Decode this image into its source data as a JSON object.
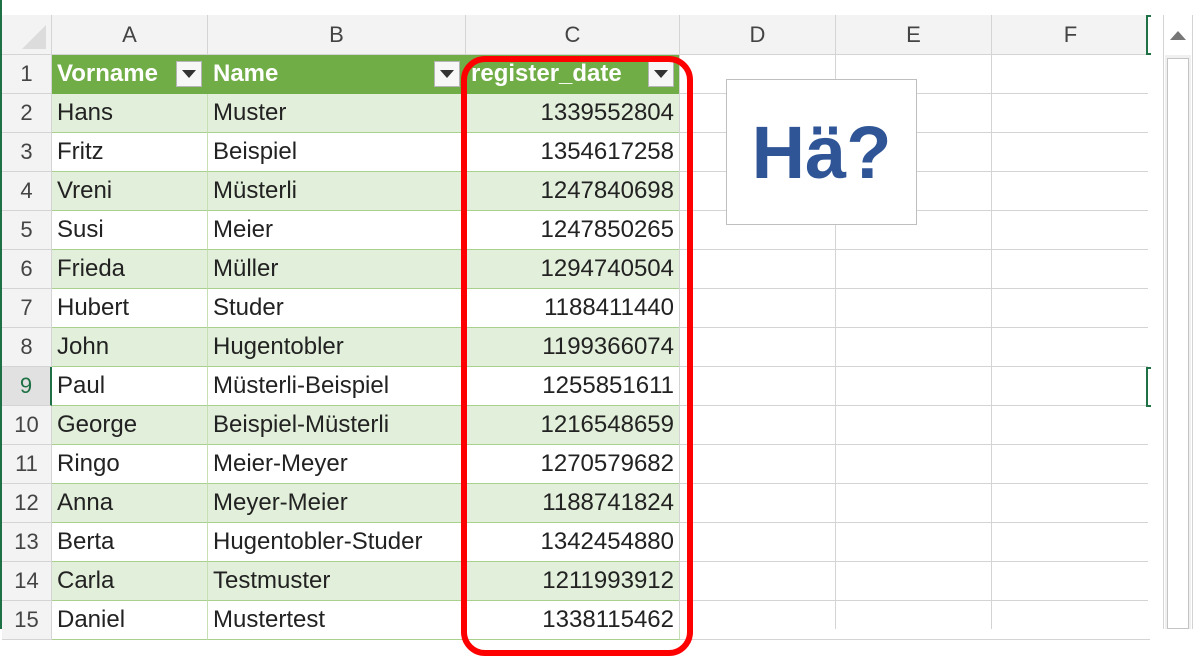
{
  "columns": [
    "A",
    "B",
    "C",
    "D",
    "E",
    "F"
  ],
  "row_numbers": [
    "1",
    "2",
    "3",
    "4",
    "5",
    "6",
    "7",
    "8",
    "9",
    "10",
    "11",
    "12",
    "13",
    "14",
    "15"
  ],
  "selected_row": "9",
  "table": {
    "headers": [
      "Vorname",
      "Name",
      "register_date"
    ],
    "rows": [
      [
        "Hans",
        "Muster",
        "1339552804"
      ],
      [
        "Fritz",
        "Beispiel",
        "1354617258"
      ],
      [
        "Vreni",
        "Müsterli",
        "1247840698"
      ],
      [
        "Susi",
        "Meier",
        "1247850265"
      ],
      [
        "Frieda",
        "Müller",
        "1294740504"
      ],
      [
        "Hubert",
        "Studer",
        "1188411440"
      ],
      [
        "John",
        "Hugentobler",
        "1199366074"
      ],
      [
        "Paul",
        "Müsterli-Beispiel",
        "1255851611"
      ],
      [
        "George",
        "Beispiel-Müsterli",
        "1216548659"
      ],
      [
        "Ringo",
        "Meier-Meyer",
        "1270579682"
      ],
      [
        "Anna",
        "Meyer-Meier",
        "1188741824"
      ],
      [
        "Berta",
        "Hugentobler-Studer",
        "1342454880"
      ],
      [
        "Carla",
        "Testmuster",
        "1211993912"
      ],
      [
        "Daniel",
        "Mustertest",
        "1338115462"
      ]
    ]
  },
  "callout_text": "Hä?",
  "colors": {
    "header_green": "#70ad47",
    "band_green": "#e2efda",
    "highlight_red": "#ff0000",
    "callout_blue": "#2f5597"
  }
}
